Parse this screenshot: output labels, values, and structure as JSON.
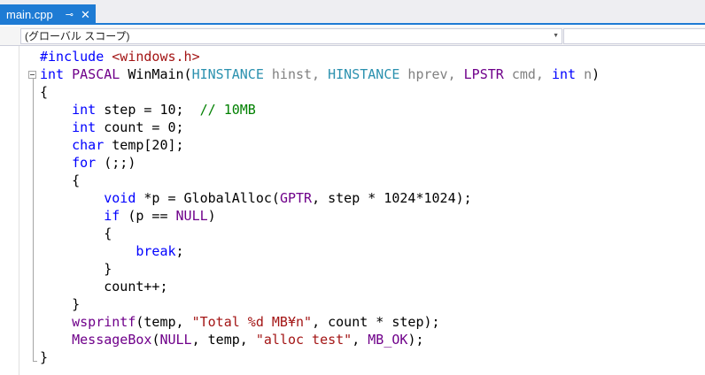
{
  "tab": {
    "title": "main.cpp",
    "pin_icon": "⊸",
    "close_icon": "✕"
  },
  "nav": {
    "scope": "(グローバル スコープ)",
    "arrow": "▼"
  },
  "colors": {
    "keyword": "#0000ff",
    "type": "#2b91af",
    "macro": "#6f008a",
    "string": "#a31515",
    "comment": "#008000"
  },
  "code_lines": [
    [
      {
        "t": "#include",
        "c": "pp"
      },
      {
        "t": " "
      },
      {
        "t": "<windows.h>",
        "c": "str"
      }
    ],
    [
      {
        "t": "int",
        "c": "kw"
      },
      {
        "t": " "
      },
      {
        "t": "PASCAL",
        "c": "mac"
      },
      {
        "t": " WinMain("
      },
      {
        "t": "HINSTANCE",
        "c": "type"
      },
      {
        "t": " hinst, ",
        "c": "param"
      },
      {
        "t": "HINSTANCE",
        "c": "type"
      },
      {
        "t": " hprev, ",
        "c": "param"
      },
      {
        "t": "LPSTR",
        "c": "mac"
      },
      {
        "t": " cmd, ",
        "c": "param"
      },
      {
        "t": "int",
        "c": "kw"
      },
      {
        "t": " n",
        "c": "param"
      },
      {
        "t": ")"
      }
    ],
    [
      {
        "t": "{"
      }
    ],
    [
      {
        "t": "    "
      },
      {
        "t": "int",
        "c": "kw"
      },
      {
        "t": " step = 10;  "
      },
      {
        "t": "// 10MB",
        "c": "cm"
      }
    ],
    [
      {
        "t": "    "
      },
      {
        "t": "int",
        "c": "kw"
      },
      {
        "t": " count = 0;"
      }
    ],
    [
      {
        "t": "    "
      },
      {
        "t": "char",
        "c": "kw"
      },
      {
        "t": " temp[20];"
      }
    ],
    [
      {
        "t": "    "
      },
      {
        "t": "for",
        "c": "kw"
      },
      {
        "t": " (;;)"
      }
    ],
    [
      {
        "t": "    {"
      }
    ],
    [
      {
        "t": "        "
      },
      {
        "t": "void",
        "c": "kw"
      },
      {
        "t": " *p = GlobalAlloc("
      },
      {
        "t": "GPTR",
        "c": "mac"
      },
      {
        "t": ", step * 1024*1024);"
      }
    ],
    [
      {
        "t": "        "
      },
      {
        "t": "if",
        "c": "kw"
      },
      {
        "t": " (p == "
      },
      {
        "t": "NULL",
        "c": "mac"
      },
      {
        "t": ")"
      }
    ],
    [
      {
        "t": "        {"
      }
    ],
    [
      {
        "t": "            "
      },
      {
        "t": "break",
        "c": "kw"
      },
      {
        "t": ";"
      }
    ],
    [
      {
        "t": "        }"
      }
    ],
    [
      {
        "t": "        count++;"
      }
    ],
    [
      {
        "t": "    }"
      }
    ],
    [
      {
        "t": "    "
      },
      {
        "t": "wsprintf",
        "c": "mac"
      },
      {
        "t": "(temp, "
      },
      {
        "t": "\"Total %d MB¥n\"",
        "c": "str"
      },
      {
        "t": ", count * step);"
      }
    ],
    [
      {
        "t": "    "
      },
      {
        "t": "MessageBox",
        "c": "mac"
      },
      {
        "t": "("
      },
      {
        "t": "NULL",
        "c": "mac"
      },
      {
        "t": ", temp, "
      },
      {
        "t": "\"alloc test\"",
        "c": "str"
      },
      {
        "t": ", "
      },
      {
        "t": "MB_OK",
        "c": "mac"
      },
      {
        "t": ");"
      }
    ],
    [
      {
        "t": "}"
      }
    ]
  ]
}
